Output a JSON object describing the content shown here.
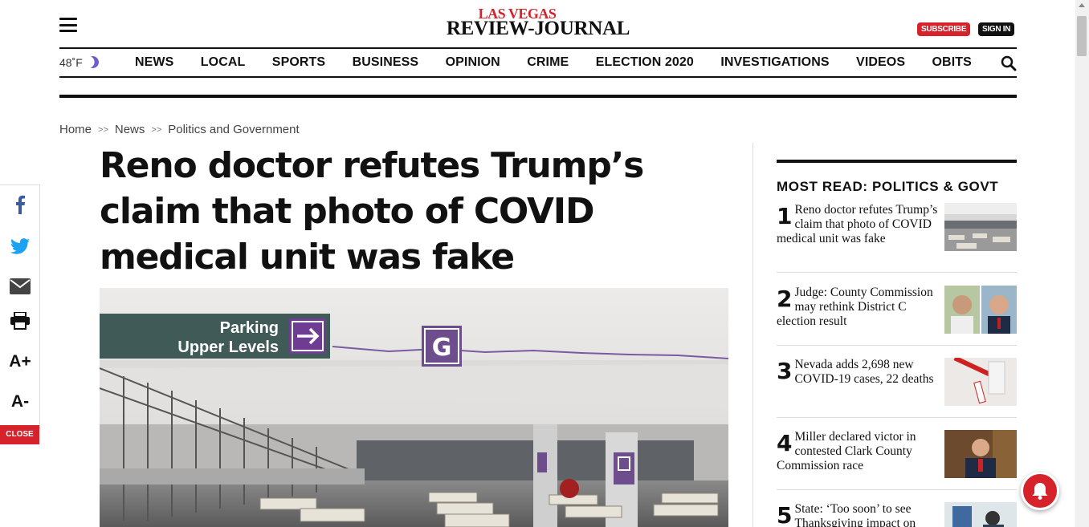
{
  "header": {
    "logo_line1": "LAS VEGAS",
    "logo_line2": "REVIEW-JOURNAL",
    "subscribe": "SUBSCRIBE",
    "sign_in": "SIGN IN",
    "menu_icon": "hamburger-icon"
  },
  "nav": {
    "weather": "48˚F",
    "weather_icon": "moon-icon",
    "items": [
      "NEWS",
      "LOCAL",
      "SPORTS",
      "BUSINESS",
      "OPINION",
      "CRIME",
      "ELECTION 2020",
      "INVESTIGATIONS",
      "VIDEOS",
      "OBITS"
    ],
    "search_icon": "search-icon"
  },
  "breadcrumb": [
    "Home",
    "News",
    "Politics and Government"
  ],
  "breadcrumb_sep": ">>",
  "article": {
    "headline": "Reno doctor refutes Trump’s claim that photo of COVID medical unit was fake",
    "photo": {
      "sign_parking_1": "Parking",
      "sign_parking_2": "Upper Levels",
      "sign_level": "G"
    }
  },
  "share": {
    "facebook_icon": "facebook-icon",
    "twitter_icon": "twitter-icon",
    "email_icon": "email-icon",
    "print_icon": "print-icon",
    "font_up": "A+",
    "font_down": "A-",
    "close": "CLOSE"
  },
  "sidebar": {
    "title": "MOST READ: POLITICS & GOVT",
    "items": [
      {
        "num": "1",
        "text": "Reno doctor refutes Trump’s claim that photo of COVID medical unit was fake"
      },
      {
        "num": "2",
        "text": "Judge: County Commission may rethink District C election result"
      },
      {
        "num": "3",
        "text": "Nevada adds 2,698 new COVID-19 cases, 22 deaths"
      },
      {
        "num": "4",
        "text": "Miller declared victor in contested Clark County Commission race"
      },
      {
        "num": "5",
        "text": "State: ‘Too soon’ to see Thanksgiving impact on"
      }
    ]
  },
  "colors": {
    "brand_red": "#d6222a",
    "text": "#111111"
  }
}
